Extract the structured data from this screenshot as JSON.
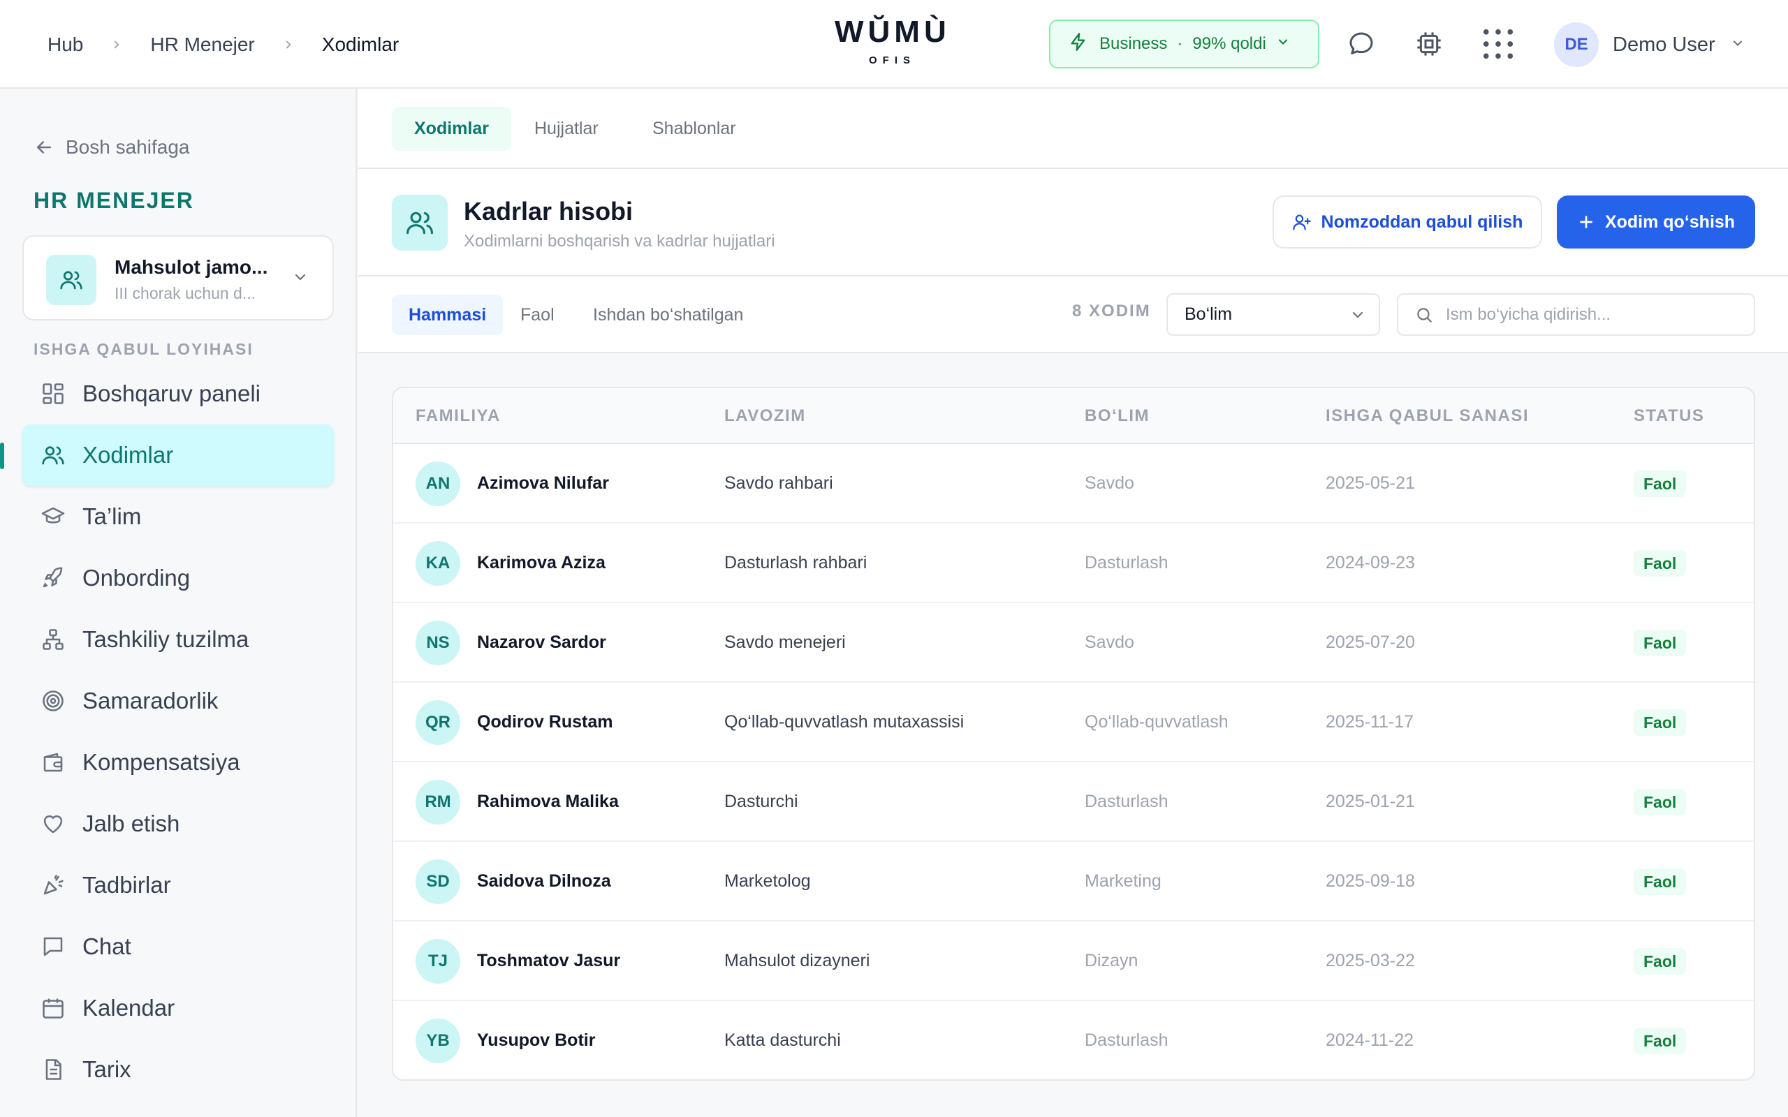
{
  "breadcrumb": [
    "Hub",
    "HR Menejer",
    "Xodimlar"
  ],
  "logo": {
    "word": "WŬMÙ",
    "sub": "OFIS"
  },
  "plan": {
    "name": "Business",
    "remaining": "99% qoldi",
    "accent": "#15803d"
  },
  "header_icons": [
    "chat-bubble-icon",
    "cpu-icon",
    "apps-grid-icon"
  ],
  "user": {
    "initials": "DE",
    "name": "Demo User"
  },
  "sidebar": {
    "back_label": "Bosh sahifaga",
    "title": "HR MENEJER",
    "project": {
      "name": "Mahsulot jamo...",
      "subtitle": "III chorak uchun d..."
    },
    "section_label": "ISHGA QABUL LOYIHASI",
    "items": [
      {
        "label": "Boshqaruv paneli",
        "icon": "dashboard-icon",
        "active": false
      },
      {
        "label": "Xodimlar",
        "icon": "users-icon",
        "active": true
      },
      {
        "label": "Ta’lim",
        "icon": "graduation-cap-icon",
        "active": false
      },
      {
        "label": "Onbording",
        "icon": "rocket-icon",
        "active": false
      },
      {
        "label": "Tashkiliy tuzilma",
        "icon": "org-chart-icon",
        "active": false
      },
      {
        "label": "Samaradorlik",
        "icon": "target-icon",
        "active": false
      },
      {
        "label": "Kompensatsiya",
        "icon": "wallet-icon",
        "active": false
      },
      {
        "label": "Jalb etish",
        "icon": "heart-icon",
        "active": false
      },
      {
        "label": "Tadbirlar",
        "icon": "party-icon",
        "active": false
      },
      {
        "label": "Chat",
        "icon": "message-square-icon",
        "active": false
      },
      {
        "label": "Kalendar",
        "icon": "calendar-icon",
        "active": false
      },
      {
        "label": "Tarix",
        "icon": "document-icon",
        "active": false
      }
    ]
  },
  "tabs": [
    {
      "label": "Xodimlar",
      "active": true
    },
    {
      "label": "Hujjatlar",
      "active": false
    },
    {
      "label": "Shablonlar",
      "active": false
    }
  ],
  "page": {
    "title": "Kadrlar hisobi",
    "subtitle": "Xodimlarni boshqarish va kadrlar hujjatlari",
    "secondary_button": "Nomzoddan qabul qilish",
    "primary_button": "Xodim qo‘shish"
  },
  "filters": {
    "tabs": [
      {
        "label": "Hammasi",
        "active": true
      },
      {
        "label": "Faol",
        "active": false
      },
      {
        "label": "Ishdan bo‘shatilgan",
        "active": false
      }
    ],
    "count": "8 XODIM",
    "department_select": "Bo‘lim",
    "search_placeholder": "Ism bo‘yicha qidirish..."
  },
  "table": {
    "columns": [
      "FAMILIYA",
      "LAVOZIM",
      "BO‘LIM",
      "ISHGA QABUL SANASI",
      "STATUS"
    ],
    "rows": [
      {
        "initials": "AN",
        "name": "Azimova Nilufar",
        "position": "Savdo rahbari",
        "department": "Savdo",
        "date": "2025-05-21",
        "status": "Faol"
      },
      {
        "initials": "KA",
        "name": "Karimova Aziza",
        "position": "Dasturlash rahbari",
        "department": "Dasturlash",
        "date": "2024-09-23",
        "status": "Faol"
      },
      {
        "initials": "NS",
        "name": "Nazarov Sardor",
        "position": "Savdo menejeri",
        "department": "Savdo",
        "date": "2025-07-20",
        "status": "Faol"
      },
      {
        "initials": "QR",
        "name": "Qodirov Rustam",
        "position": "Qo‘llab-quvvatlash mutaxassisi",
        "department": "Qo‘llab-quvvatlash",
        "date": "2025-11-17",
        "status": "Faol"
      },
      {
        "initials": "RM",
        "name": "Rahimova Malika",
        "position": "Dasturchi",
        "department": "Dasturlash",
        "date": "2025-01-21",
        "status": "Faol"
      },
      {
        "initials": "SD",
        "name": "Saidova Dilnoza",
        "position": "Marketolog",
        "department": "Marketing",
        "date": "2025-09-18",
        "status": "Faol"
      },
      {
        "initials": "TJ",
        "name": "Toshmatov Jasur",
        "position": "Mahsulot dizayneri",
        "department": "Dizayn",
        "date": "2025-03-22",
        "status": "Faol"
      },
      {
        "initials": "YB",
        "name": "Yusupov Botir",
        "position": "Katta dasturchi",
        "department": "Dasturlash",
        "date": "2024-11-22",
        "status": "Faol"
      }
    ]
  },
  "colors": {
    "primary": "#2563eb",
    "accent_teal": "#0f766e",
    "active_bg": "#cffafe",
    "status_green": "#15803d"
  }
}
